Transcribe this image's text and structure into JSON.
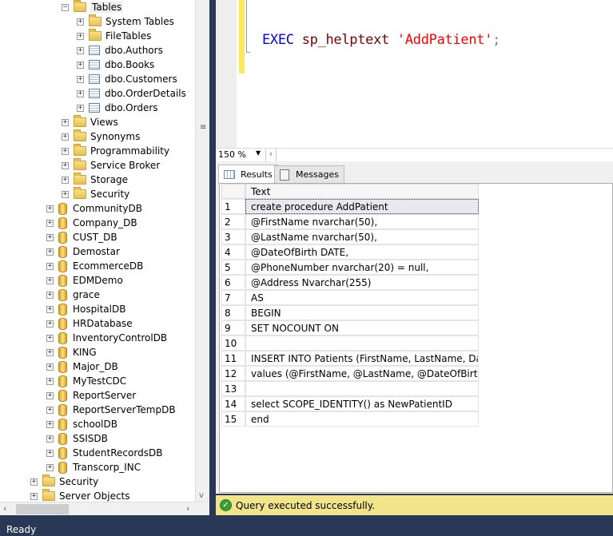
{
  "tree": {
    "tables": "Tables",
    "table_children": [
      "System Tables",
      "FileTables",
      "dbo.Authors",
      "dbo.Books",
      "dbo.Customers",
      "dbo.OrderDetails",
      "dbo.Orders"
    ],
    "db_folders": [
      "Views",
      "Synonyms",
      "Programmability",
      "Service Broker",
      "Storage",
      "Security"
    ],
    "databases": [
      "CommunityDB",
      "Company_DB",
      "CUST_DB",
      "Demostar",
      "EcommerceDB",
      "EDMDemo",
      "grace",
      "HospitalDB",
      "HRDatabase",
      "InventoryControlDB",
      "KING",
      "Major_DB",
      "MyTestCDC",
      "ReportServer",
      "ReportServerTempDB",
      "schoolDB",
      "SSISDB",
      "StudentRecordsDB",
      "Transcorp_INC"
    ],
    "server_folders": [
      "Security",
      "Server Objects"
    ]
  },
  "editor": {
    "keyword": "EXEC",
    "proc": "sp_helptext",
    "arg": "'AddPatient'",
    "end": ";"
  },
  "zoom": {
    "level": "150 %"
  },
  "tabs": {
    "results": "Results",
    "messages": "Messages"
  },
  "grid": {
    "header": "Text",
    "rows": [
      {
        "n": "1",
        "text": "create procedure AddPatient"
      },
      {
        "n": "2",
        "text": "@FirstName nvarchar(50),"
      },
      {
        "n": "3",
        "text": "@LastName nvarchar(50),"
      },
      {
        "n": "4",
        "text": "@DateOfBirth DATE,"
      },
      {
        "n": "5",
        "text": "@PhoneNumber nvarchar(20)  = null,"
      },
      {
        "n": "6",
        "text": "@Address Nvarchar(255)"
      },
      {
        "n": "7",
        "text": "AS"
      },
      {
        "n": "8",
        "text": "BEGIN"
      },
      {
        "n": "9",
        "text": "SET NOCOUNT ON"
      },
      {
        "n": "10",
        "text": ""
      },
      {
        "n": "11",
        "text": "INSERT INTO Patients (FirstName, LastName, DateOfBi..."
      },
      {
        "n": "12",
        "text": "values (@FirstName, @LastName, @DateOfBirth, @Ph..."
      },
      {
        "n": "13",
        "text": ""
      },
      {
        "n": "14",
        "text": "select SCOPE_IDENTITY() as NewPatientID"
      },
      {
        "n": "15",
        "text": "end"
      }
    ]
  },
  "status": {
    "message": "Query executed successfully.",
    "bar": "Ready"
  }
}
